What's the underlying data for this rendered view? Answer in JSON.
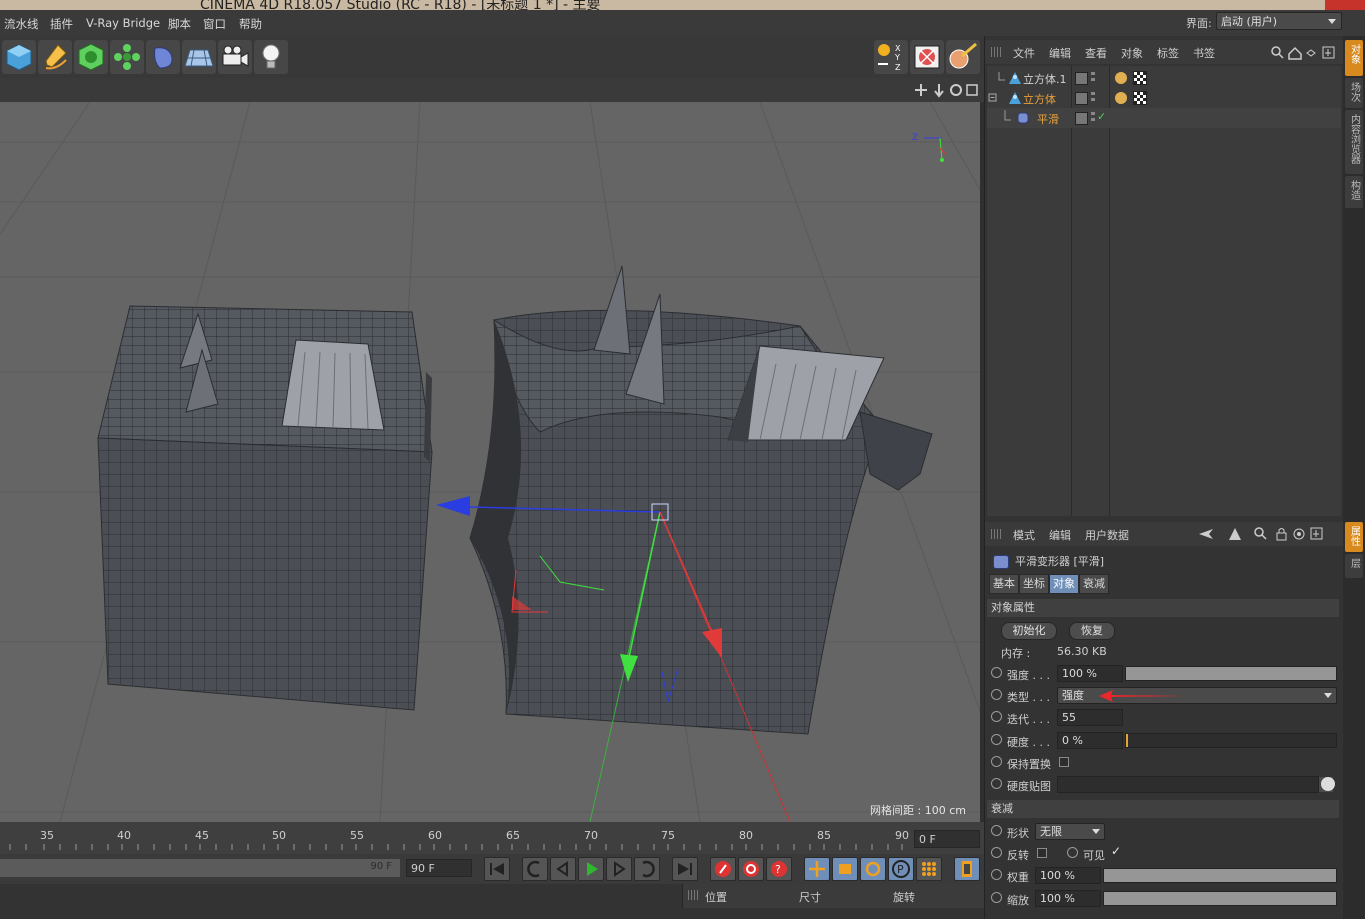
{
  "window": {
    "title": "CINEMA 4D R18.057 Studio (RC - R18) - [未标题 1 *] - 主要"
  },
  "menubar": {
    "items": [
      "流水线",
      "插件",
      "V-Ray Bridge",
      "脚本",
      "窗口",
      "帮助"
    ],
    "interface_label": "界面:",
    "interface_value": "启动 (用户)"
  },
  "toolbar": {
    "left_tools": [
      "cube-icon",
      "pen-icon",
      "subdivision-icon",
      "array-icon",
      "deformer-icon",
      "floor-icon",
      "camera-icon",
      "light-icon"
    ],
    "right_tools": [
      "coordinate-system-icon",
      "render-view-icon",
      "render-settings-icon"
    ]
  },
  "viewport": {
    "grid_label": "网格间距 : 100 cm"
  },
  "timeline": {
    "ticks": [
      "35",
      "40",
      "45",
      "50",
      "55",
      "60",
      "65",
      "70",
      "75",
      "80",
      "85",
      "90"
    ],
    "current_frame": "0 F",
    "range_end": "90 F",
    "end_frame": "90 F"
  },
  "coordinates": {
    "headers": [
      "位置",
      "尺寸",
      "旋转"
    ]
  },
  "object_manager": {
    "menu": [
      "文件",
      "编辑",
      "查看",
      "对象",
      "标签",
      "书签"
    ],
    "objects": [
      {
        "name": "立方体.1",
        "color": "#d2d2d2"
      },
      {
        "name": "立方体",
        "color": "#e8a23a"
      },
      {
        "name": "平滑",
        "color": "#e8a23a"
      }
    ]
  },
  "attribute_manager": {
    "menu": [
      "模式",
      "编辑",
      "用户数据"
    ],
    "title": "平滑变形器 [平滑]",
    "tabs": [
      "基本",
      "坐标",
      "对象",
      "衰减"
    ],
    "active_tab": "对象",
    "section_object": "对象属性",
    "btn_init": "初始化",
    "btn_restore": "恢复",
    "memory_label": "内存 :",
    "memory_value": "56.30 KB",
    "strength_label": "强度 . . .",
    "strength_value": "100 %",
    "type_label": "类型 . . .",
    "type_value": "强度",
    "iterations_label": "迭代 . . .",
    "iterations_value": "55",
    "stiffness_label": "硬度 . . .",
    "stiffness_value": "0 %",
    "keep_label": "保持置换",
    "stiffness_map_label": "硬度贴图",
    "section_falloff": "衰减",
    "shape_label": "形状",
    "shape_value": "无限",
    "invert_label": "反转",
    "visible_label": "可见",
    "weight_label": "权重",
    "weight_value": "100 %",
    "scale_label": "缩放",
    "scale_value": "100 %"
  },
  "side_tabs": {
    "top": [
      "对象",
      "场次",
      "内容浏览器",
      "构造"
    ],
    "bottom": [
      "属性",
      "层"
    ]
  },
  "colors": {
    "accent_orange": "#d88a1e",
    "active_tab": "#6f8fb8",
    "annotation_red": "#e8282a"
  }
}
